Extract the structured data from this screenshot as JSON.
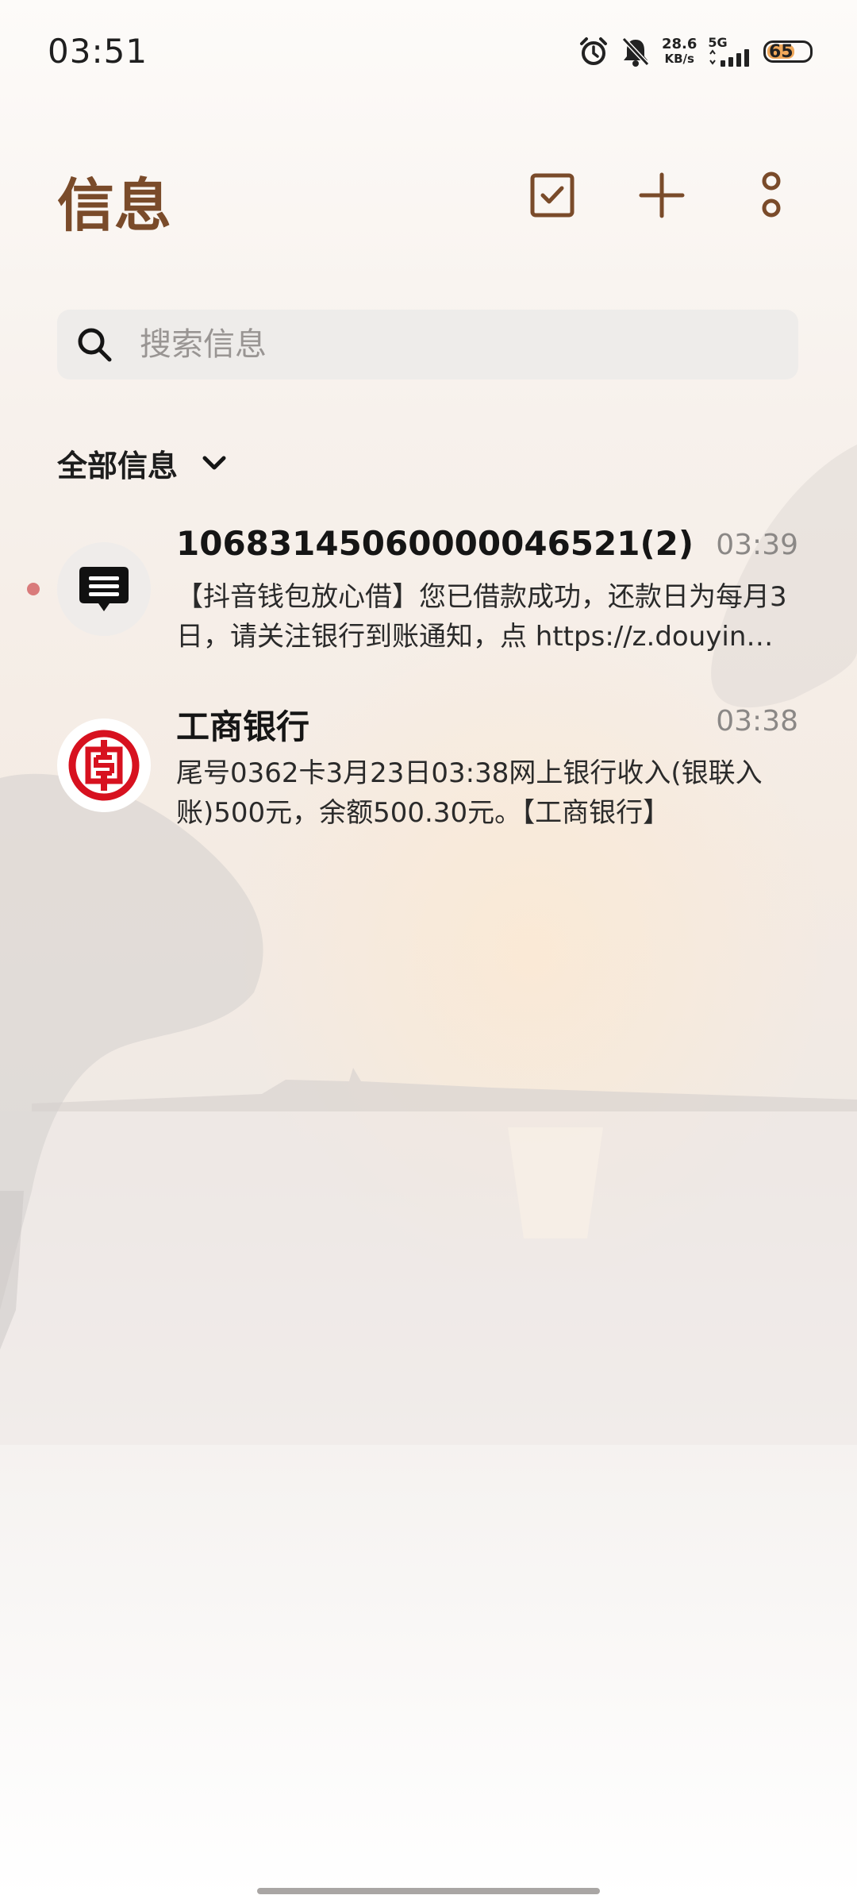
{
  "status_bar": {
    "time": "03:51",
    "net_speed_value": "28.6",
    "net_speed_unit": "KB/s",
    "network_type": "5G",
    "battery": "65",
    "battery_level": 0.65,
    "icons": [
      "alarm-icon",
      "bell-muted-icon",
      "signal-icon",
      "battery-icon"
    ]
  },
  "header": {
    "title": "信息",
    "actions": [
      "select-checkbox-icon",
      "plus-icon",
      "more-vertical-icon"
    ]
  },
  "search": {
    "placeholder": "搜索信息"
  },
  "filter": {
    "label": "全部信息"
  },
  "messages": [
    {
      "sender": "10683145060000046521(2)",
      "time": "03:39",
      "preview": "【抖音钱包放心借】您已借款成功，还款日为每月3日，请关注银行到账通知，点 https://z.douyin…",
      "unread": true,
      "avatar_icon": "message-icon"
    },
    {
      "sender": "工商银行",
      "time": "03:38",
      "preview": "尾号0362卡3月23日03:38网上银行收入(银联入账)500元，余额500.30元。【工商银行】",
      "unread": false,
      "avatar_icon": "icbc-logo-icon"
    }
  ],
  "colors": {
    "accent": "#7a4b2a",
    "icbc_red": "#d7111f",
    "unread_dot": "#d97b7b"
  }
}
